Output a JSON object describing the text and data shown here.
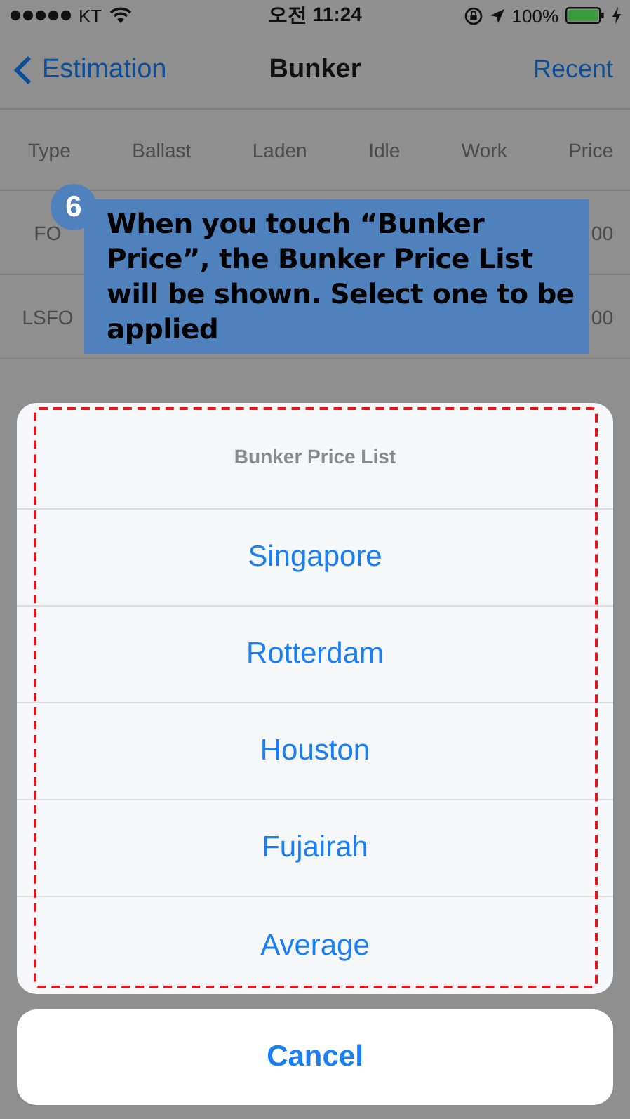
{
  "status_bar": {
    "carrier": "KT",
    "time": "오전 11:24",
    "battery": "100%"
  },
  "nav": {
    "back": "Estimation",
    "title": "Bunker",
    "action": "Recent"
  },
  "table": {
    "columns": [
      "Type",
      "Ballast",
      "Laden",
      "Idle",
      "Work",
      "Price"
    ],
    "rows": [
      {
        "type": "FO",
        "price": "00"
      },
      {
        "type": "LSFO",
        "price": "00"
      }
    ]
  },
  "callout": {
    "number": "6",
    "text": "When you touch “Bunker Price”, the Bunker Price List will be shown. Select one to be applied"
  },
  "action_sheet": {
    "title": "Bunker Price List",
    "options": [
      "Singapore",
      "Rotterdam",
      "Houston",
      "Fujairah",
      "Average"
    ],
    "cancel": "Cancel"
  }
}
